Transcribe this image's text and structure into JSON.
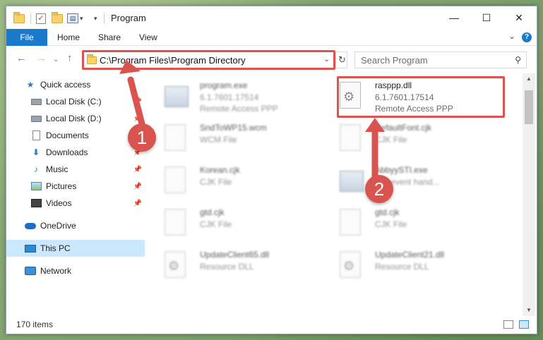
{
  "window": {
    "title": "Program"
  },
  "titlebar": {
    "minimize": "—",
    "maximize": "☐",
    "close": "✕"
  },
  "ribbon": {
    "tabs": [
      "File",
      "Home",
      "Share",
      "View"
    ],
    "help": "?"
  },
  "address": {
    "path": "C:\\Program Files\\Program Directory"
  },
  "search": {
    "placeholder": "Search Program"
  },
  "nav": {
    "items": [
      {
        "label": "Quick access"
      },
      {
        "label": "Local Disk (C:)"
      },
      {
        "label": "Local Disk (D:)"
      },
      {
        "label": "Documents"
      },
      {
        "label": "Downloads"
      },
      {
        "label": "Music"
      },
      {
        "label": "Pictures"
      },
      {
        "label": "Videos"
      },
      {
        "label": "OneDrive"
      },
      {
        "label": "This PC"
      },
      {
        "label": "Network"
      }
    ]
  },
  "files": [
    {
      "name": "program.exe",
      "line2": "6.1.7601.17514",
      "line3": "Remote Access PPP"
    },
    {
      "name": "rasppp.dll",
      "line2": "6.1.7601.17514",
      "line3": "Remote Access PPP"
    },
    {
      "name": "SndToWP15.wcm",
      "line2": "WCM File"
    },
    {
      "name": "DefaultFont.cjk",
      "line2": "CJK File"
    },
    {
      "name": "Korean.cjk",
      "line2": "CJK File"
    },
    {
      "name": "AbbyySTI.exe",
      "line2": "STI event hand..."
    },
    {
      "name": "gtd.cjk",
      "line2": "CJK File"
    },
    {
      "name": "gtd.cjk",
      "line2": "CJK File"
    },
    {
      "name": "UpdateClient65.dll",
      "line2": "Resource DLL"
    },
    {
      "name": "UpdateClient21.dll",
      "line2": "Resource DLL"
    }
  ],
  "annotations": {
    "step1": "1",
    "step2": "2",
    "accent": "#d9534f"
  },
  "status": {
    "count": "170 items"
  }
}
